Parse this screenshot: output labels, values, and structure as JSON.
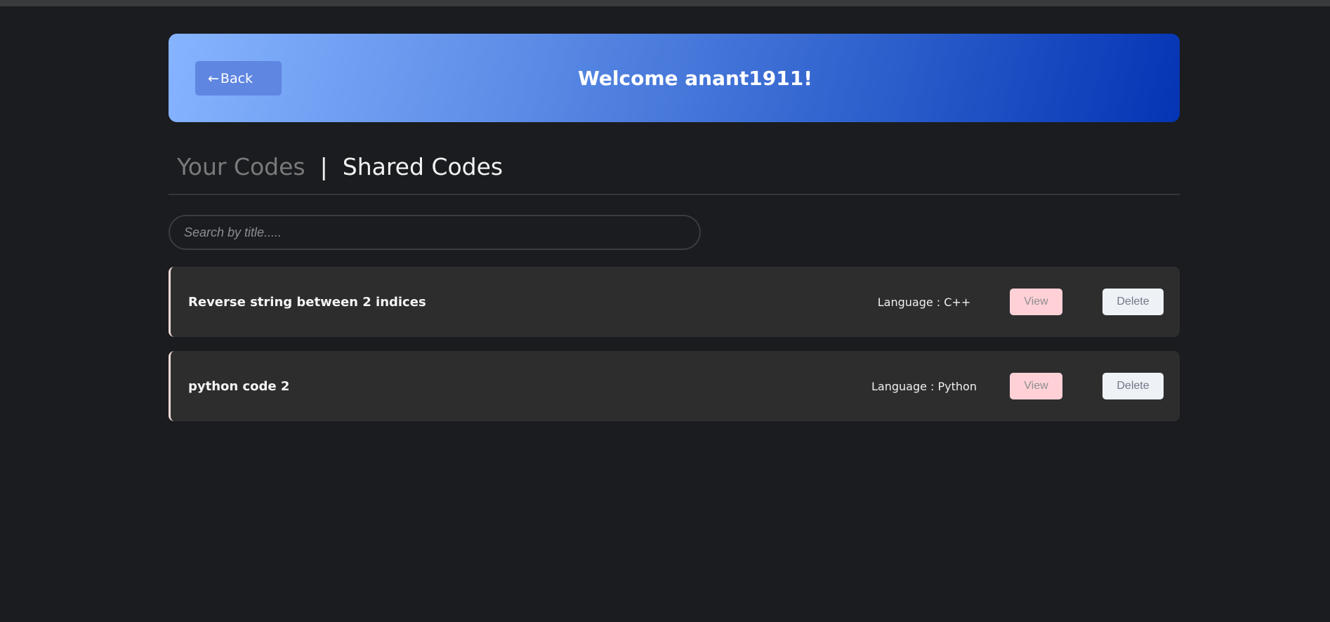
{
  "header": {
    "back_label": "Back",
    "back_arrow": "←",
    "welcome_text": "Welcome anant1911!"
  },
  "tabs": [
    {
      "label": "Your Codes",
      "active": false
    },
    {
      "label": "Shared Codes",
      "active": true
    }
  ],
  "tab_separator": "|",
  "search": {
    "placeholder": "Search by title.....",
    "value": ""
  },
  "codes": [
    {
      "title": "Reverse string between 2 indices",
      "language": "Language : C++",
      "view_label": "View",
      "delete_label": "Delete"
    },
    {
      "title": "python code 2",
      "language": "Language : Python",
      "view_label": "View",
      "delete_label": "Delete"
    }
  ],
  "colors": {
    "background": "#1b1c1f",
    "card": "#2d2d2e",
    "header_gradient_start": "#86b4ff",
    "header_gradient_end": "#0534b4",
    "view_button": "#ffd1d6",
    "delete_button": "#eef2f7"
  },
  "icons": {
    "back": "left-arrow-icon"
  }
}
